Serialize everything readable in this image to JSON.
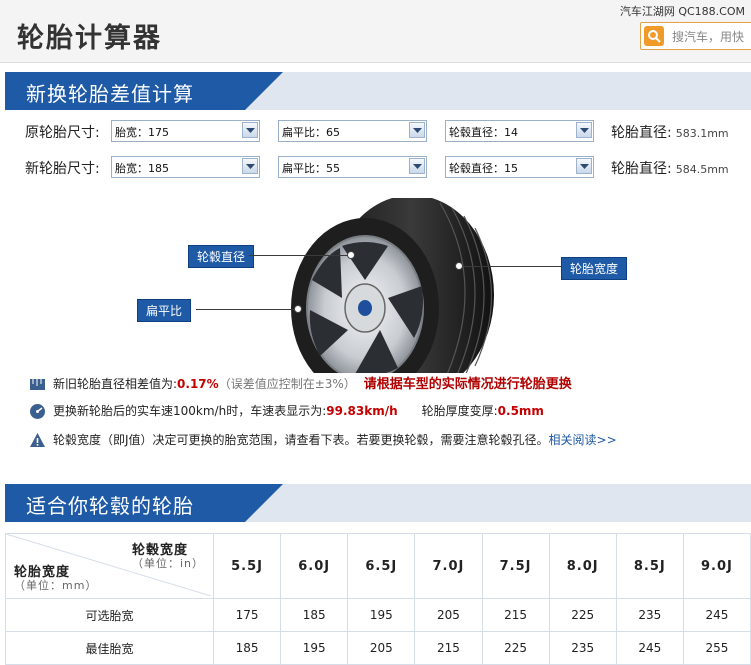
{
  "header": {
    "title": "轮胎计算器",
    "brand": "汽车江湖网 QC188.COM",
    "search_placeholder": "搜汽车，用快"
  },
  "section1": {
    "title": "新换轮胎差值计算",
    "original": {
      "label": "原轮胎尺寸:",
      "width": "胎宽：175",
      "aspect": "扁平比：65",
      "rim": "轮毂直径：14",
      "dia_label": "轮胎直径:",
      "dia_value": "583.1mm"
    },
    "new": {
      "label": "新轮胎尺寸:",
      "width": "胎宽：185",
      "aspect": "扁平比：55",
      "rim": "轮毂直径：15",
      "dia_label": "轮胎直径:",
      "dia_value": "584.5mm"
    },
    "callouts": {
      "rim_dia": "轮毂直径",
      "aspect": "扁平比",
      "width": "轮胎宽度"
    },
    "info": {
      "line1_prefix": "新旧轮胎直径相差值为:",
      "line1_value": "0.17%",
      "line1_note": "（误差值应控制在±3%）",
      "line1_warn": "请根据车型的实际情况进行轮胎更换",
      "line2_prefix": "更换新轮胎后的实车速100km/h时，车速表显示为:",
      "line2_value": "99.83km/h",
      "line2_mid": "轮胎厚度变厚:",
      "line2_value2": "0.5mm",
      "line3_text": "轮毂宽度（即J值）决定可更换的胎宽范围，请查看下表。若要更换轮毂，需要注意轮毂孔径。",
      "line3_link": "相关阅读>>"
    }
  },
  "section2": {
    "title": "适合你轮毂的轮胎",
    "corner": {
      "col_title": "轮毂宽度",
      "col_unit": "（单位：in）",
      "row_title": "轮胎宽度",
      "row_unit": "（单位：mm）"
    },
    "columns": [
      "5.5J",
      "6.0J",
      "6.5J",
      "7.0J",
      "7.5J",
      "8.0J",
      "8.5J",
      "9.0J"
    ],
    "rows": [
      {
        "label": "可选胎宽",
        "values": [
          "175",
          "185",
          "195",
          "205",
          "215",
          "225",
          "235",
          "245"
        ]
      },
      {
        "label": "最佳胎宽",
        "values": [
          "185",
          "195",
          "205",
          "215",
          "225",
          "235",
          "245",
          "255"
        ]
      }
    ]
  },
  "colors": {
    "banner_blue": "#1f5aa6",
    "accent_red": "#c40000",
    "search_orange": "#f09a2a"
  }
}
